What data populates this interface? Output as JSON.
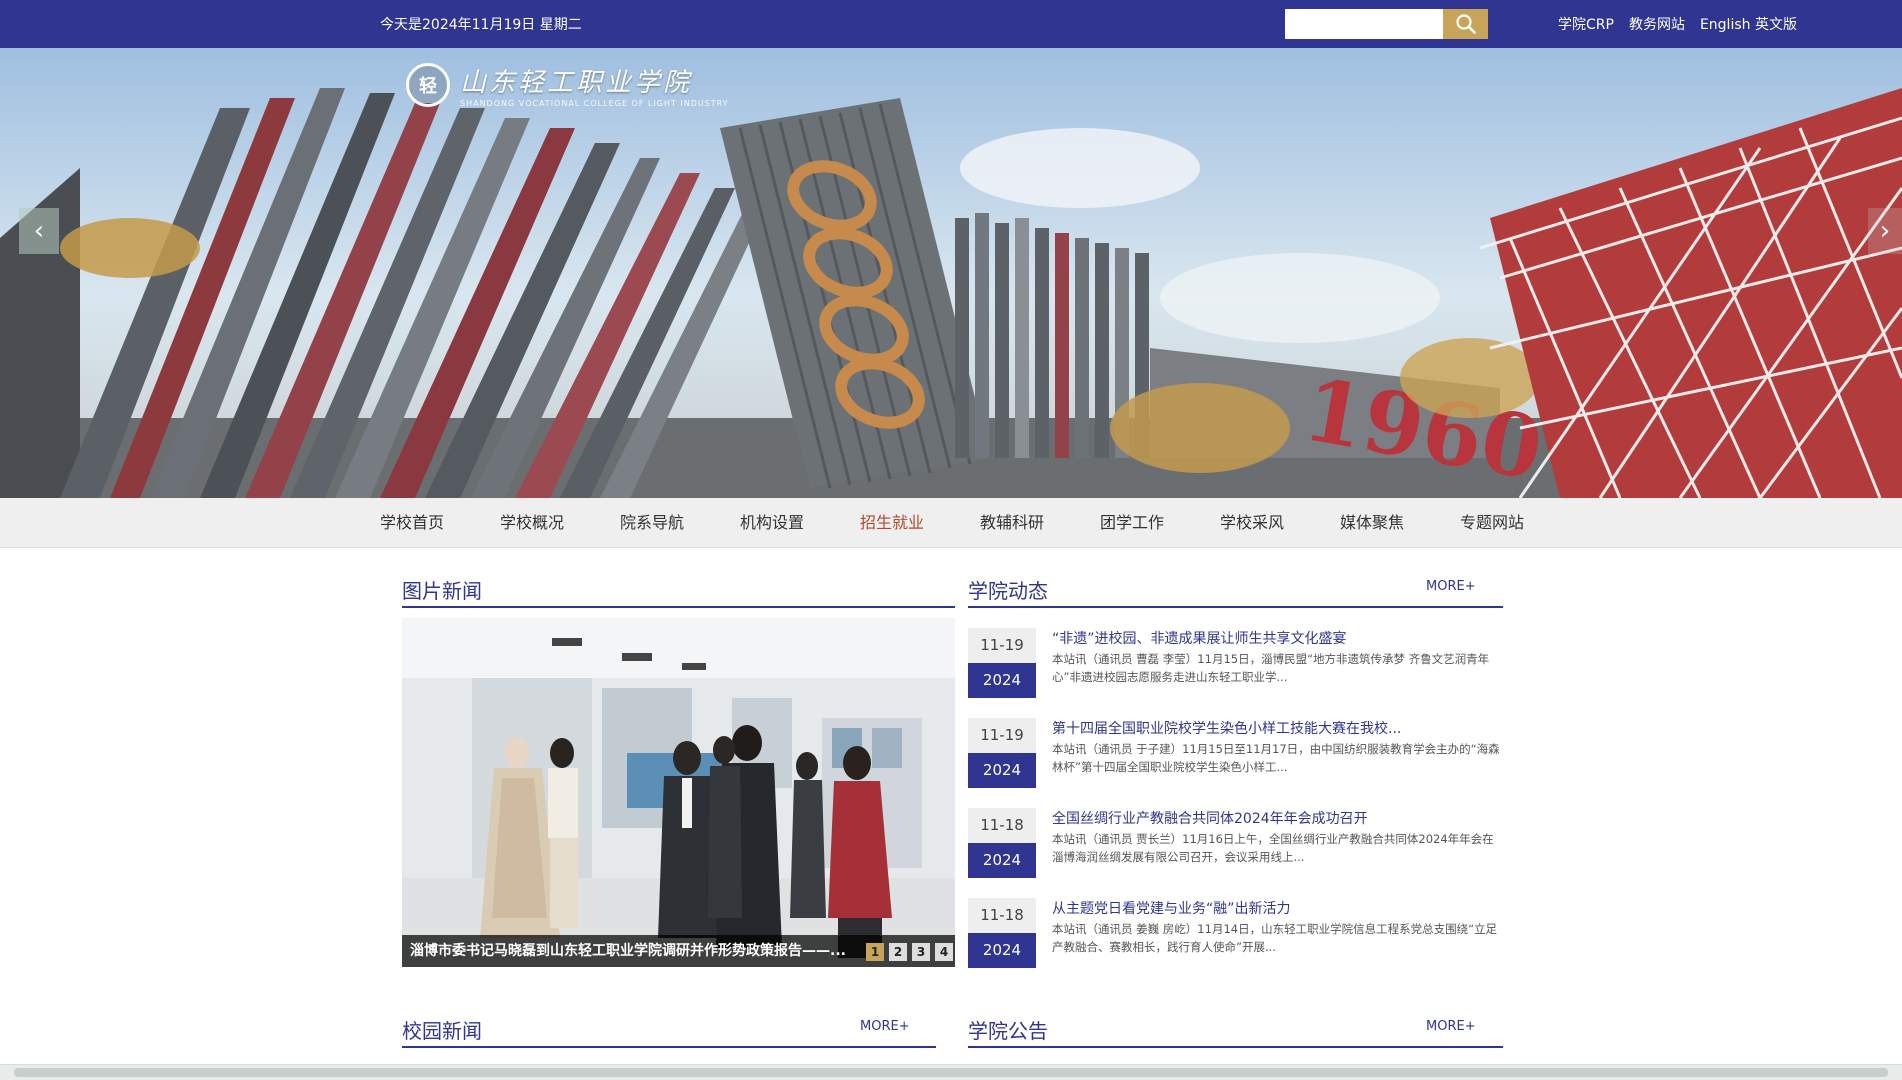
{
  "topbar": {
    "date_text": "今天是2024年11月19日 星期二",
    "search_placeholder": "",
    "links": [
      "学院CRP",
      "教务网站",
      "English 英文版"
    ]
  },
  "banner": {
    "logo_cn": "山东轻工职业学院",
    "logo_en": "SHANDONG VOCATIONAL COLLEGE OF LIGHT INDUSTRY",
    "logo_mark": "轻"
  },
  "nav": {
    "items": [
      "学校首页",
      "学校概况",
      "院系导航",
      "机构设置",
      "招生就业",
      "教辅科研",
      "团学工作",
      "学校采风",
      "媒体聚焦",
      "专题网站"
    ],
    "active_index": 4
  },
  "photo_news": {
    "title": "图片新闻",
    "caption": "淄博市委书记马晓磊到山东轻工职业学院调研并作形势政策报告——...",
    "pages": [
      "1",
      "2",
      "3",
      "4"
    ]
  },
  "college_news": {
    "title": "学院动态",
    "more": "MORE+",
    "items": [
      {
        "md": "11-19",
        "year": "2024",
        "title": "“非遗”进校园、非遗成果展让师生共享文化盛宴",
        "summary": "本站讯（通讯员 曹磊 李莹）11月15日，淄博民盟“地方非遗筑传承梦 齐鲁文艺润青年心”非遗进校园志愿服务走进山东轻工职业学..."
      },
      {
        "md": "11-19",
        "year": "2024",
        "title": "第十四届全国职业院校学生染色小样工技能大赛在我校...",
        "summary": "本站讯（通讯员 于子建）11月15日至11月17日，由中国纺织服装教育学会主办的“海森林杯”第十四届全国职业院校学生染色小样工..."
      },
      {
        "md": "11-18",
        "year": "2024",
        "title": "全国丝绸行业产教融合共同体2024年年会成功召开",
        "summary": "本站讯（通讯员 贾长兰）11月16日上午，全国丝绸行业产教融合共同体2024年年会在淄博海润丝绸发展有限公司召开，会议采用线上..."
      },
      {
        "md": "11-18",
        "year": "2024",
        "title": "从主题党日看党建与业务“融”出新活力",
        "summary": "本站讯（通讯员 姜巍 房屹）11月14日，山东轻工职业学院信息工程系党总支围绕“立足产教融合、赛教相长，践行育人使命”开展..."
      }
    ]
  },
  "campus_news": {
    "title": "校园新闻",
    "more": "MORE+"
  },
  "announcements": {
    "title": "学院公告",
    "more": "MORE+"
  }
}
